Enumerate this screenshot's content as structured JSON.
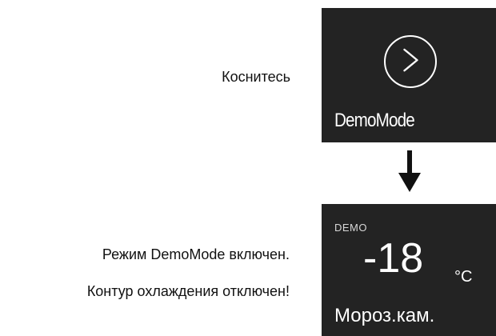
{
  "instructions": {
    "touch": "Коснитесь",
    "status_line_1": "Режим DemoMode включен.",
    "status_line_2": "Контур охлаждения отключен!"
  },
  "top_screen": {
    "button_icon": "chevron-right-circle-icon",
    "label": "DemoMode"
  },
  "transition_icon": "arrow-down-icon",
  "bottom_screen": {
    "tag": "DEMO",
    "temperature": "-18",
    "unit": "°C",
    "zone": "Мороз.кам."
  },
  "colors": {
    "screen_background": "#232323",
    "screen_text": "#ffffff",
    "page_background": "#ffffff",
    "page_text": "#111111"
  }
}
